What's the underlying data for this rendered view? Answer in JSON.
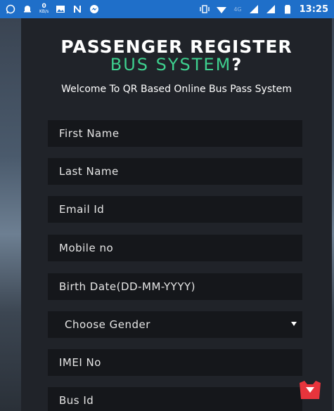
{
  "status_bar": {
    "time": "13:25",
    "network_label": "4G",
    "data_speed": "0",
    "data_unit": "KB/s",
    "bg_color": "#1f6fc9"
  },
  "header": {
    "title_line1": "PASSENGER REGISTER",
    "title_line2": "BUS SYSTEM",
    "title_suffix": "?",
    "accent_color": "#3ecf8e",
    "subtitle": "Welcome To QR Based Online Bus Pass System"
  },
  "form": {
    "first_name": "First Name",
    "last_name": "Last Name",
    "email": "Email Id",
    "mobile": "Mobile no",
    "birth_date": "Birth Date(DD-MM-YYYY)",
    "gender_select": "Choose Gender",
    "imei": "IMEI No",
    "bus_id": "Bus Id"
  },
  "icons": {
    "status_left": [
      "whatsapp-icon",
      "notification-bell-icon",
      "data-speed-icon",
      "gallery-icon",
      "n-app-icon",
      "messenger-icon"
    ],
    "status_right": [
      "vibrate-icon",
      "wifi-icon",
      "signal-icon",
      "signal-icon",
      "battery-icon"
    ],
    "floating": "floating-badge-icon"
  }
}
